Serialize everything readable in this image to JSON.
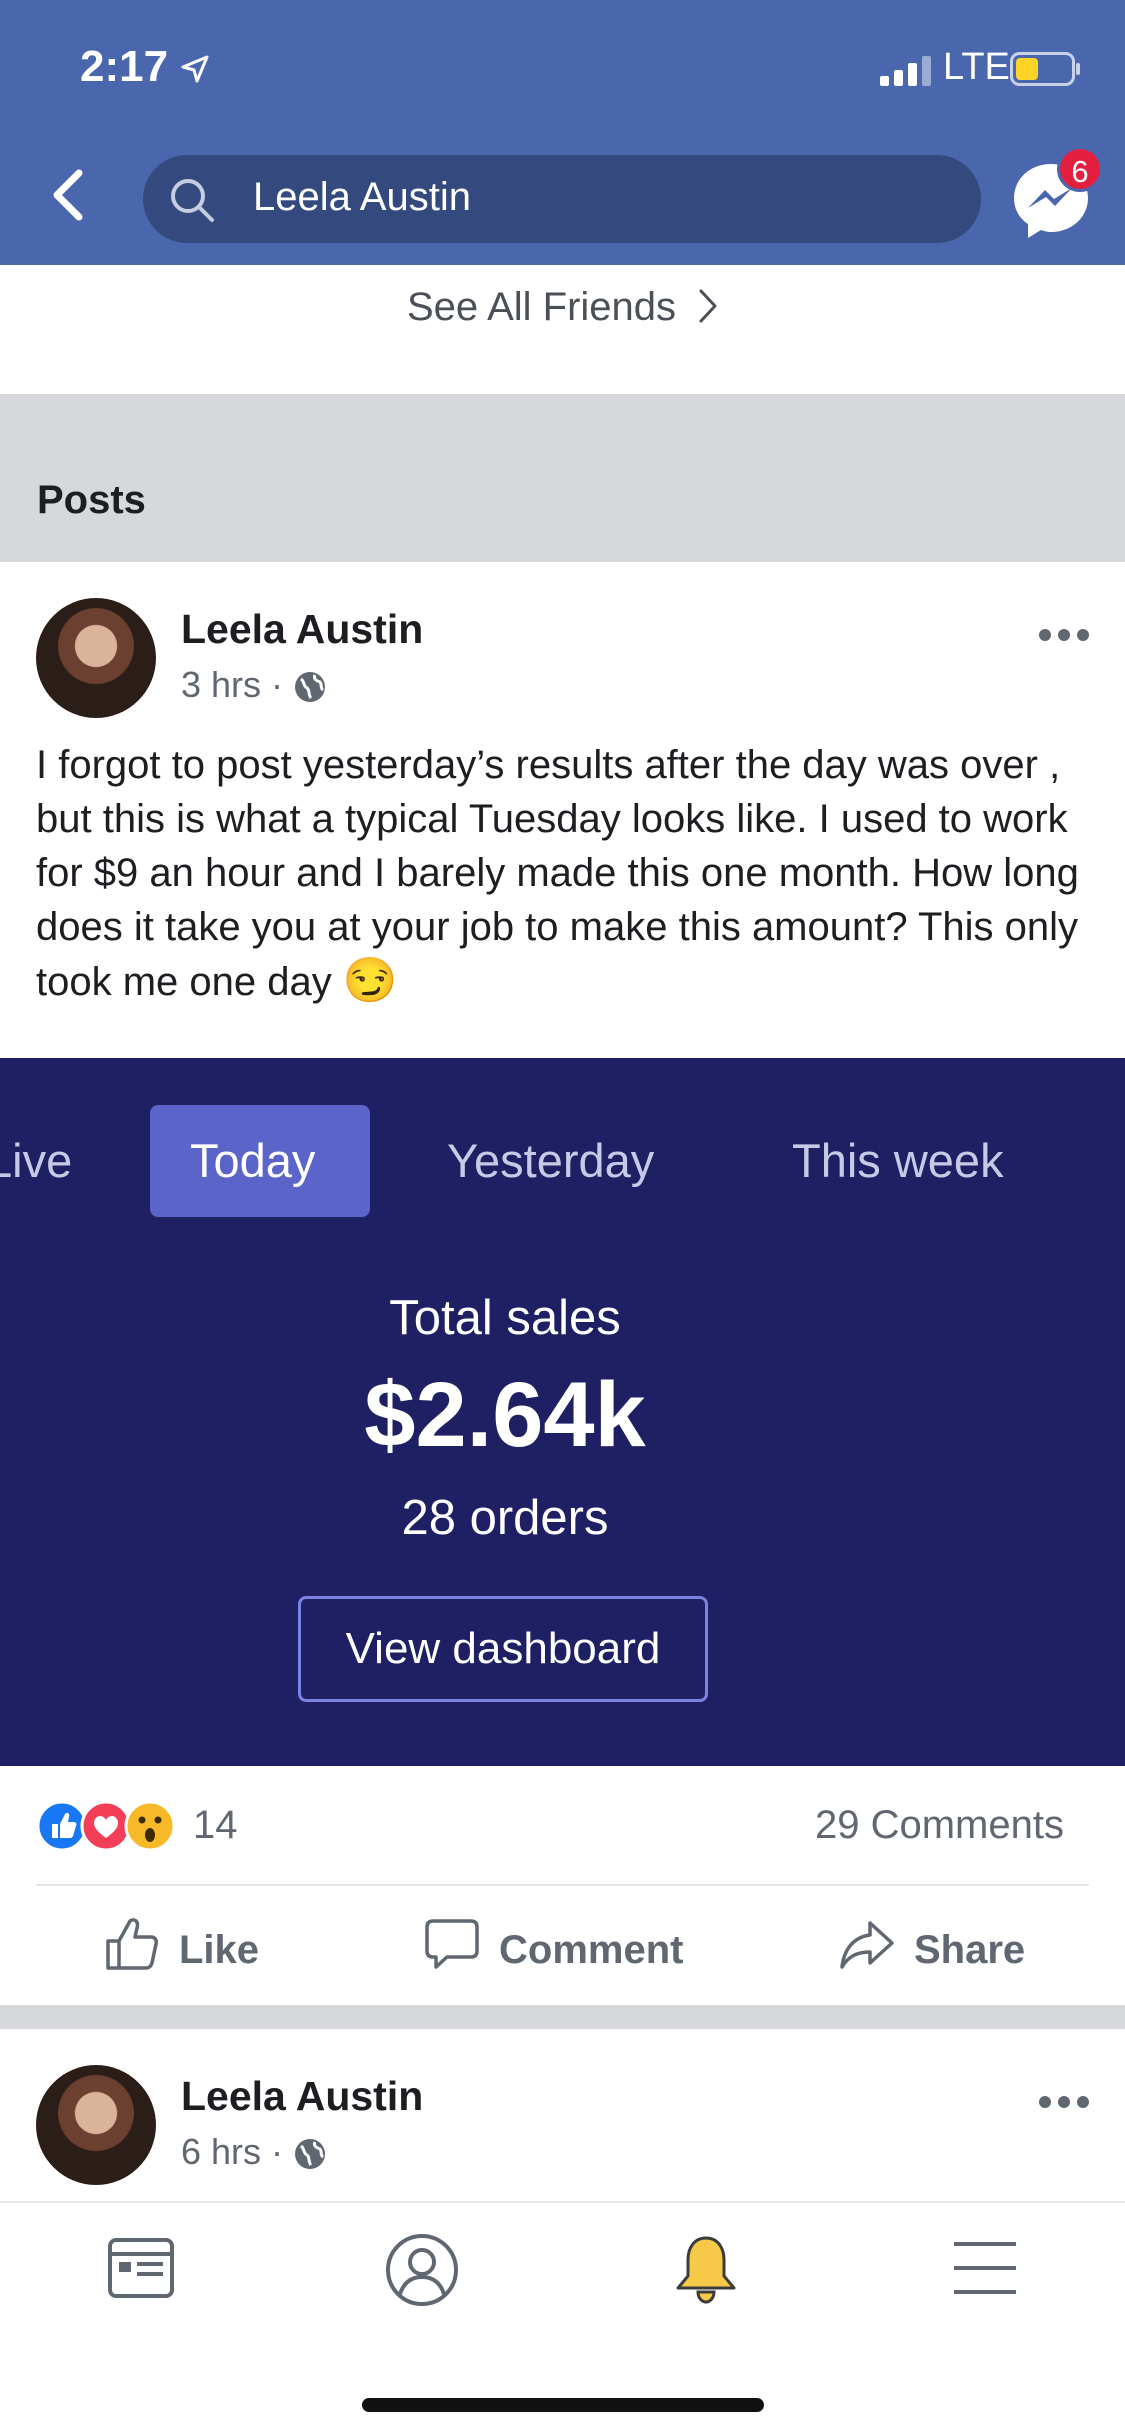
{
  "status_bar": {
    "time": "2:17",
    "network": "LTE"
  },
  "nav": {
    "search_text": "Leela Austin",
    "messenger_badge": "6",
    "colors": {
      "bar": "#4a66ad",
      "search_bg": "#34497e",
      "badge": "#e41e3f"
    }
  },
  "friends": {
    "see_all_label": "See All Friends"
  },
  "section": {
    "posts_heading": "Posts"
  },
  "posts": [
    {
      "author": "Leela Austin",
      "time": "3 hrs",
      "text": "I forgot to post yesterday’s results after the day was over , but this is what a typical Tuesday looks like. I used to work for $9 an hour and I barely made this one month. How long does it take you at your job to make this amount? This only took me one day",
      "emoji": "😏",
      "image": {
        "tabs": [
          "Live",
          "Today",
          "Yesterday",
          "This week"
        ],
        "selected_tab": "Today",
        "total_label": "Total sales",
        "total_value": "$2.64k",
        "orders": "28 orders",
        "button": "View dashboard",
        "colors": {
          "background": "#1f2063",
          "selected_tab": "#5b64c8"
        }
      },
      "reaction_count": "14",
      "comments_label": "29 Comments",
      "actions": {
        "like": "Like",
        "comment": "Comment",
        "share": "Share"
      }
    },
    {
      "author": "Leela Austin",
      "time": "6 hrs"
    }
  ],
  "tab_bar": {
    "icons": [
      "news-feed-icon",
      "profile-icon",
      "notifications-bell-icon",
      "menu-icon"
    ]
  }
}
